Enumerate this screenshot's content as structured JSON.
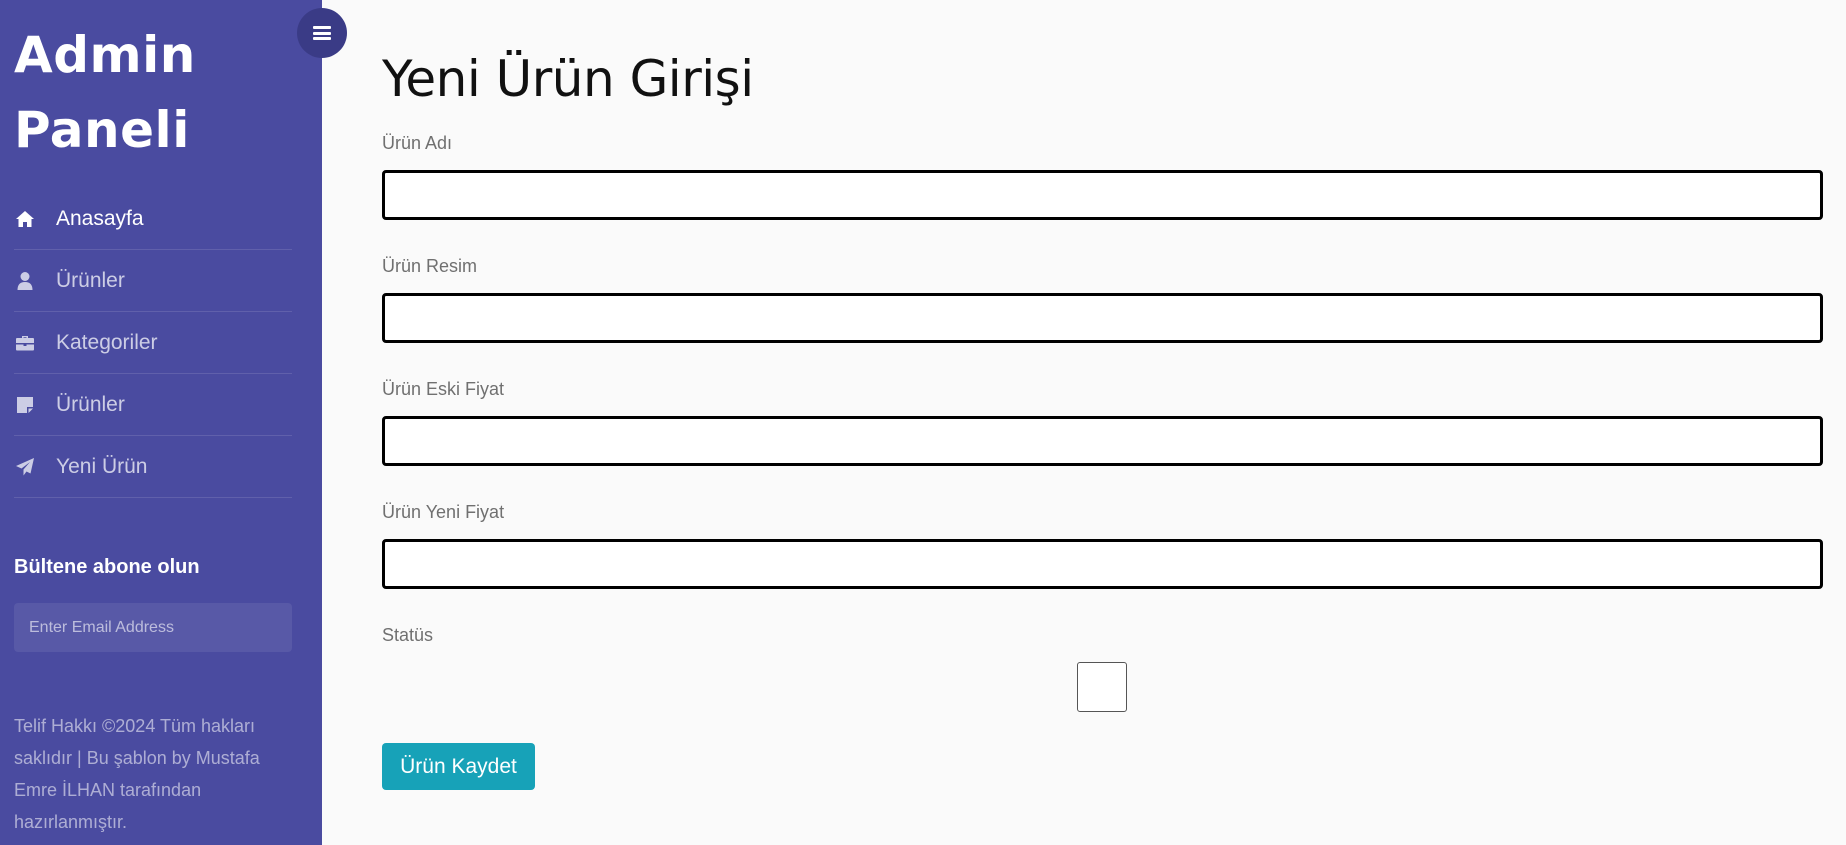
{
  "sidebar": {
    "logo_line1": "Admin",
    "logo_line2": "Paneli",
    "items": [
      {
        "label": "Anasayfa",
        "icon": "home-icon"
      },
      {
        "label": "Ürünler",
        "icon": "user-icon"
      },
      {
        "label": "Kategoriler",
        "icon": "briefcase-icon"
      },
      {
        "label": "Ürünler",
        "icon": "sticky-note-icon"
      },
      {
        "label": "Yeni Ürün",
        "icon": "paper-plane-icon"
      }
    ],
    "newsletter_title": "Bültene abone olun",
    "email_placeholder": "Enter Email Address",
    "copyright": "Telif Hakkı ©2024 Tüm hakları saklıdır | Bu şablon by Mustafa Emre İLHAN tarafından hazırlanmıştır."
  },
  "main": {
    "title": "Yeni Ürün Girişi",
    "fields": [
      {
        "label": "Ürün Adı",
        "value": ""
      },
      {
        "label": "Ürün Resim",
        "value": ""
      },
      {
        "label": "Ürün Eski Fiyat",
        "value": ""
      },
      {
        "label": "Ürün Yeni Fiyat",
        "value": ""
      }
    ],
    "status_label": "Statüs",
    "status_checked": false,
    "save_label": "Ürün Kaydet"
  },
  "colors": {
    "sidebar_bg": "#4a4ba0",
    "toggle_bg": "#3a3b86",
    "button": "#17a2b8"
  }
}
